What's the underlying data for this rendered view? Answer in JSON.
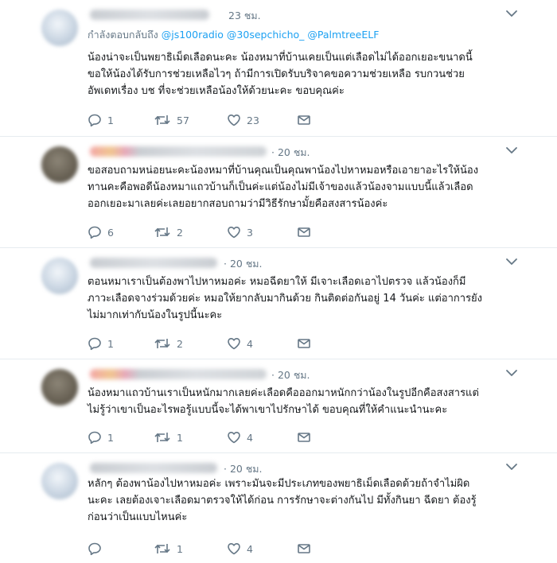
{
  "tweets": [
    {
      "time": "23 ชม.",
      "replying_prefix": "กำลังตอบกลับถึง",
      "mentions": [
        "@js100radio",
        "@30sepchicho_",
        "@PalmtreeELF"
      ],
      "lines": [
        "น้องน่าจะเป็นพยาธิเม็ดเลือดนะคะ น้องหมาที่บ้านเคยเป็นแต่เลือดไม่ได้ออกเยอะขนาดนี้",
        "ขอให้น้องได้รับการช่วยเหลือไวๆ ถ้ามีการเปิดรับบริจาคขอความช่วยเหลือ รบกวนช่วย",
        "อัพเดทเรื่อง บช ที่จะช่วยเหลือน้องให้ด้วยนะคะ ขอบคุณค่ะ"
      ],
      "reply_count": "1",
      "retweet_count": "57",
      "like_count": "23"
    },
    {
      "time": "· 20 ชม.",
      "lines": [
        "ขอสอบถามหน่อยนะคะน้องหมาที่บ้านคุณเป็นคุณพาน้องไปหาหมอหรือเอายาอะไรให้น้อง",
        "ทานคะคือพอดีน้องหมาแถวบ้านก็เป็นค่ะแต่น้องไม่มีเจ้าของแล้วน้องจามแบบนี้แล้วเลือด",
        "ออกเยอะมาเลยค่ะเลยอยากสอบถามว่ามีวิธีรักษามั้ยคือสงสารน้องค่ะ"
      ],
      "reply_count": "6",
      "retweet_count": "2",
      "like_count": "3"
    },
    {
      "time": "· 20 ชม.",
      "lines": [
        "ตอนหมาเราเป็นต้องพาไปหาหมอค่ะ หมอฉีดยาให้ มีเจาะเลือดเอาไปตรวจ แล้วน้องก็มี",
        "ภาวะเลือดจางร่วมด้วยค่ะ หมอให้ยากลับมากินด้วย กินติดต่อกันอยู่ 14 วันค่ะ แต่อาการยัง",
        "ไม่มากเท่ากับน้องในรูปนี้นะคะ"
      ],
      "reply_count": "1",
      "retweet_count": "2",
      "like_count": "4"
    },
    {
      "time": "· 20 ชม.",
      "lines": [
        "น้องหมาแถวบ้านเราเป็นหนักมากเลยค่ะเลือดคือออกมาหนักกว่าน้องในรูปอีกคือสงสารแต่",
        "ไม่รู้ว่าเขาเป็นอะไรพอรู้แบบนี้จะได้พาเขาไปรักษาได้ ขอบคุณที่ให้คำแนะนำนะคะ"
      ],
      "reply_count": "1",
      "retweet_count": "1",
      "like_count": "4"
    },
    {
      "time": "· 20 ชม.",
      "lines": [
        "หลักๆ ต้องพาน้องไปหาหมอค่ะ เพราะมันจะมีประเภทของพยาธิเม็ดเลือดด้วยถ้าจำไม่ผิด",
        "นะคะ เลยต้องเจาะเลือดมาตรวจให้ได้ก่อน การรักษาจะต่างกันไป มีทั้งกินยา ฉีดยา ต้องรู้",
        "ก่อนว่าเป็นแบบไหนค่ะ"
      ],
      "reply_count": "",
      "retweet_count": "1",
      "like_count": "4"
    }
  ],
  "colors": {
    "mention": "#1da1f2",
    "muted": "#657786",
    "text": "#14171a",
    "divider": "#e6ecf0"
  },
  "icons": [
    "reply-icon",
    "retweet-icon",
    "like-icon",
    "direct-message-icon",
    "chevron-down-icon"
  ]
}
